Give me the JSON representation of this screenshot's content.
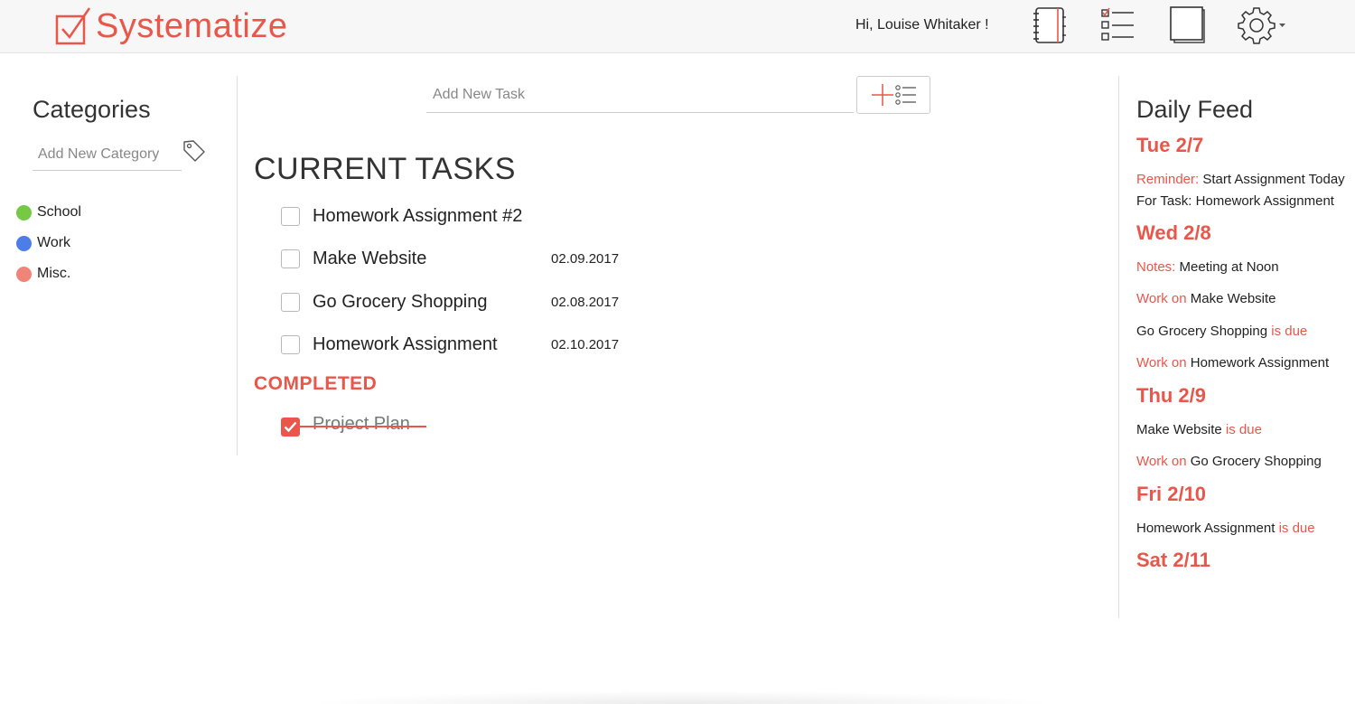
{
  "app": {
    "name": "Systematize",
    "greeting": "Hi, Louise Whitaker !",
    "brand_color": "#e9564a"
  },
  "nav": {
    "icons": [
      "notebook-icon",
      "checklist-icon",
      "sticky-notes-icon",
      "gear-icon",
      "chevron-down-icon"
    ]
  },
  "categories": {
    "title": "Categories",
    "input_placeholder": "Add New Category",
    "items": [
      {
        "label": "School",
        "color": "#76c945"
      },
      {
        "label": "Work",
        "color": "#4d7de8"
      },
      {
        "label": "Misc.",
        "color": "#f08478"
      }
    ]
  },
  "tasks": {
    "input_placeholder": "Add New Task",
    "current_title": "CURRENT TASKS",
    "current": [
      {
        "name": "Homework Assignment #2",
        "date": ""
      },
      {
        "name": "Make Website",
        "date": "02.09.2017"
      },
      {
        "name": "Go Grocery Shopping",
        "date": "02.08.2017"
      },
      {
        "name": "Homework Assignment",
        "date": "02.10.2017"
      }
    ],
    "completed_title": "COMPLETED",
    "completed": [
      {
        "name": "Project Plan"
      }
    ]
  },
  "feed": {
    "title": "Daily Feed",
    "days": [
      {
        "label": "Tue 2/7",
        "entries": [
          {
            "red": "Reminder:",
            "text": " Start Assignment Today"
          },
          {
            "red": "",
            "text": "For Task: Homework Assignment"
          }
        ]
      },
      {
        "label": "Wed 2/8",
        "entries": [
          {
            "red": "Notes:",
            "text": " Meeting at Noon"
          },
          {
            "red": "Work on",
            "text": " Make Website"
          },
          {
            "text": "Go Grocery Shopping",
            "red_after": " is due"
          },
          {
            "red": "Work on",
            "text": " Homework Assignment"
          }
        ]
      },
      {
        "label": "Thu 2/9",
        "entries": [
          {
            "text": "Make Website",
            "red_after": " is due"
          },
          {
            "red": "Work on",
            "text": " Go Grocery Shopping"
          }
        ]
      },
      {
        "label": "Fri 2/10",
        "entries": [
          {
            "text": "Homework Assignment",
            "red_after": " is due"
          }
        ]
      },
      {
        "label": "Sat 2/11",
        "entries": []
      }
    ]
  }
}
